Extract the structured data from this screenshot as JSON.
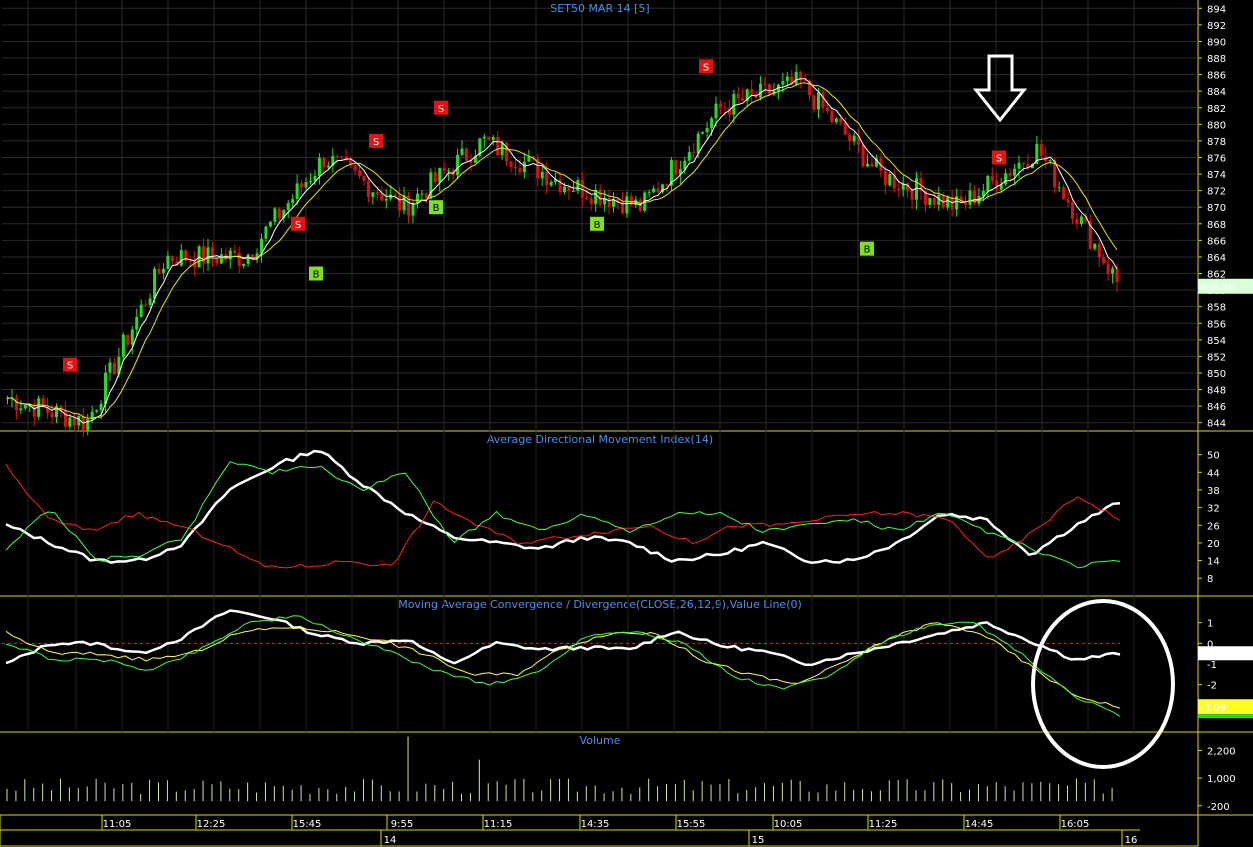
{
  "chart_data": [
    {
      "type": "candlestick",
      "title": "SET50 MAR 14   [5]",
      "y_ticks": [
        844,
        846,
        848,
        850,
        852,
        854,
        856,
        858,
        860,
        862,
        864,
        866,
        868,
        870,
        872,
        874,
        876,
        878,
        880,
        882,
        884,
        886,
        888,
        890,
        892,
        894
      ],
      "ylim": [
        843,
        895
      ],
      "last_price": "860.40",
      "grid": true,
      "key_points": [
        {
          "time": "09:35",
          "close": 847
        },
        {
          "time": "11:05",
          "close": 844
        },
        {
          "time": "12:25",
          "close": 864
        },
        {
          "time": "13:05",
          "close": 864
        },
        {
          "time": "15:45",
          "close": 876
        },
        {
          "time": "9:55",
          "close": 870
        },
        {
          "time": "10:05",
          "close": 878
        },
        {
          "time": "11:15",
          "close": 873
        },
        {
          "time": "14:35",
          "close": 870
        },
        {
          "time": "15:05",
          "close": 882
        },
        {
          "time": "15:55",
          "close": 885
        },
        {
          "time": "10:05",
          "close": 874
        },
        {
          "time": "11:25",
          "close": 870
        },
        {
          "time": "14:45",
          "close": 877
        },
        {
          "time": "16:05",
          "close": 861
        }
      ],
      "signals": [
        {
          "label": "S",
          "time": "10:25",
          "price": 851
        },
        {
          "label": "S",
          "time": "13:55",
          "price": 868
        },
        {
          "label": "B",
          "time": "14:15",
          "price": 862
        },
        {
          "label": "S",
          "time": "16:05",
          "price": 878
        },
        {
          "label": "S",
          "time": "10:25",
          "price": 882
        },
        {
          "label": "B",
          "time": "10:05",
          "price": 870
        },
        {
          "label": "B",
          "time": "14:35",
          "price": 868
        },
        {
          "label": "S",
          "time": "15:55",
          "price": 887
        },
        {
          "label": "B",
          "time": "11:35",
          "price": 865
        },
        {
          "label": "S",
          "time": "14:45",
          "price": 876
        }
      ]
    },
    {
      "type": "line",
      "title": "Average Directional Movement Index(14)",
      "y_ticks": [
        8,
        14,
        20,
        26,
        32,
        38,
        44,
        50
      ],
      "ylim": [
        4,
        56
      ],
      "series": [
        {
          "color": "#ffffff",
          "values": [
            26,
            20,
            14,
            14,
            20,
            38,
            46,
            52,
            40,
            30,
            22,
            20,
            18,
            22,
            20,
            14,
            16,
            20,
            14,
            14,
            20,
            30,
            28,
            16,
            26,
            34
          ]
        },
        {
          "color": "#ff2020",
          "values": [
            46,
            28,
            24,
            30,
            26,
            20,
            12,
            12,
            14,
            12,
            34,
            26,
            20,
            22,
            24,
            26,
            20,
            26,
            26,
            28,
            30,
            30,
            28,
            14,
            24,
            36,
            28
          ]
        },
        {
          "color": "#40ff40",
          "values": [
            18,
            32,
            14,
            16,
            22,
            48,
            44,
            46,
            38,
            44,
            20,
            30,
            24,
            30,
            24,
            30,
            30,
            24,
            26,
            28,
            24,
            30,
            24,
            18,
            12,
            14
          ]
        }
      ]
    },
    {
      "type": "line",
      "title": "Moving Average Convergence / Divergence(CLOSE,26,12,9),Value Line(0)",
      "y_ticks": [
        1,
        0,
        -2,
        -3
      ],
      "extra_tick": "-1",
      "ylim": [
        -4,
        2
      ],
      "zero_line": true,
      "last_values": [
        "-0.48",
        "-3.09"
      ],
      "series": [
        {
          "color": "#ffffff",
          "values": [
            -1,
            0,
            0,
            -0.5,
            0.3,
            1.6,
            1.2,
            0.4,
            0,
            0.2,
            -1,
            0,
            -0.3,
            -0.2,
            -0.3,
            0.6,
            -0.1,
            -0.4,
            -1,
            -0.5,
            0,
            0.5,
            1,
            0.1,
            -0.8,
            -0.48
          ]
        },
        {
          "color": "#ffff40",
          "values": [
            0.5,
            -0.5,
            -0.5,
            -0.8,
            -0.5,
            0.5,
            0.8,
            0.6,
            0.2,
            -0.5,
            -1.5,
            -1.5,
            -0.2,
            0.5,
            0.5,
            -0.8,
            -1.5,
            -2,
            -1,
            0.2,
            1,
            0.5,
            -1,
            -2.5,
            -3.09
          ]
        },
        {
          "color": "#40ff40",
          "values": [
            0,
            -0.8,
            -0.8,
            -1.3,
            -0.3,
            1,
            1.3,
            0.4,
            -0.5,
            -1.4,
            -2,
            -1.4,
            0.4,
            0.6,
            0,
            -1.6,
            -2.2,
            -1.6,
            0,
            0.8,
            1,
            -0.6,
            -2.5,
            -3.5
          ]
        }
      ]
    },
    {
      "type": "bar",
      "title": "Volume",
      "y_ticks": [
        "2,200",
        "1,000",
        "-200"
      ],
      "ylim": [
        -600,
        3000
      ]
    }
  ],
  "x_axis": {
    "time_labels": [
      "11:05",
      "12:25",
      "15:45",
      "9:55",
      "11:15",
      "14:35",
      "15:55",
      "10:05",
      "11:25",
      "14:45",
      "16:05"
    ],
    "day_labels": [
      "14",
      "15",
      "16"
    ]
  }
}
